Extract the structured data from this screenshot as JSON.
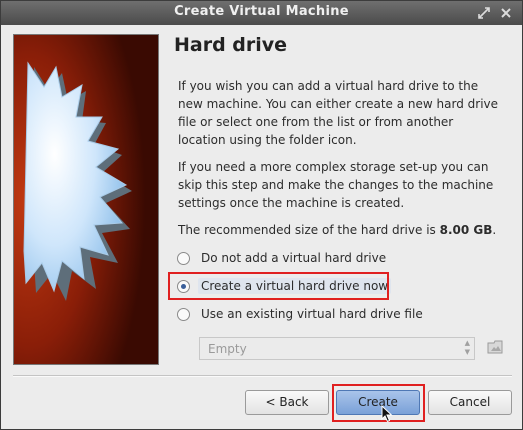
{
  "window": {
    "title": "Create Virtual Machine"
  },
  "page": {
    "heading": "Hard drive",
    "paragraph1": "If you wish you can add a virtual hard drive to the new machine. You can either create a new hard drive file or select one from the list or from another location using the folder icon.",
    "paragraph2": "If you need a more complex storage set-up you can skip this step and make the changes to the machine settings once the machine is created.",
    "paragraph3_prefix": "The recommended size of the hard drive is ",
    "paragraph3_size": "8.00 GB",
    "paragraph3_suffix": "."
  },
  "options": {
    "no_disk": "Do not add a virtual hard drive",
    "create_now": "Create a virtual hard drive now",
    "use_existing": "Use an existing virtual hard drive file",
    "selected": "create_now"
  },
  "existing_disk": {
    "value": "Empty"
  },
  "buttons": {
    "back": "< Back",
    "create": "Create",
    "cancel": "Cancel"
  },
  "icons": {
    "maximize": "maximize-icon",
    "close": "close-icon",
    "folder": "folder-icon",
    "wizard_art": "starburst-image",
    "cursor": "mouse-cursor-icon"
  },
  "colors": {
    "highlight": "#e02020",
    "accent_button": "#7aa1d8",
    "art_background": "#7a1a08"
  }
}
